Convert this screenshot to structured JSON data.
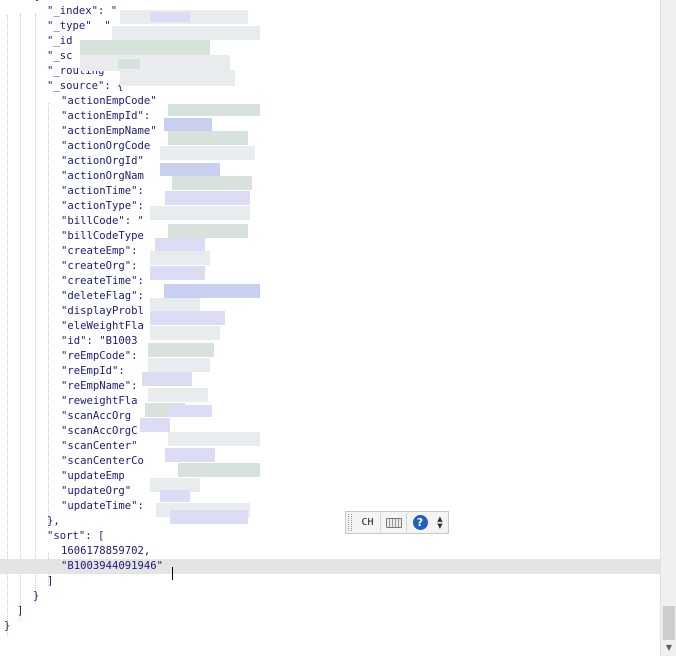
{
  "editor": {
    "lines": [
      {
        "indent": 2,
        "text": "{"
      },
      {
        "indent": 3,
        "text": "\"_index\": \""
      },
      {
        "indent": 3,
        "text": "\"_type\"  \""
      },
      {
        "indent": 3,
        "text": "\"_id"
      },
      {
        "indent": 3,
        "text": "\"_sc"
      },
      {
        "indent": 3,
        "text": "\"_routing"
      },
      {
        "indent": 3,
        "text": "\"_source\": {"
      },
      {
        "indent": 4,
        "text": "\"actionEmpCode\""
      },
      {
        "indent": 4,
        "text": "\"actionEmpId\":"
      },
      {
        "indent": 4,
        "text": "\"actionEmpName\""
      },
      {
        "indent": 4,
        "text": "\"actionOrgCode"
      },
      {
        "indent": 4,
        "text": "\"actionOrgId\""
      },
      {
        "indent": 4,
        "text": "\"actionOrgNam"
      },
      {
        "indent": 4,
        "text": "\"actionTime\":"
      },
      {
        "indent": 4,
        "text": "\"actionType\":"
      },
      {
        "indent": 4,
        "text": "\"billCode\": \""
      },
      {
        "indent": 4,
        "text": "\"billCodeType"
      },
      {
        "indent": 4,
        "text": "\"createEmp\":"
      },
      {
        "indent": 4,
        "text": "\"createOrg\":"
      },
      {
        "indent": 4,
        "text": "\"createTime\":"
      },
      {
        "indent": 4,
        "text": "\"deleteFlag\":"
      },
      {
        "indent": 4,
        "text": "\"displayProbl"
      },
      {
        "indent": 4,
        "text": "\"eleWeightFla"
      },
      {
        "indent": 4,
        "text": "\"id\": \"B1003"
      },
      {
        "indent": 4,
        "text": "\"reEmpCode\":"
      },
      {
        "indent": 4,
        "text": "\"reEmpId\":"
      },
      {
        "indent": 4,
        "text": "\"reEmpName\":"
      },
      {
        "indent": 4,
        "text": "\"reweightFla"
      },
      {
        "indent": 4,
        "text": "\"scanAccOrg"
      },
      {
        "indent": 4,
        "text": "\"scanAccOrgC"
      },
      {
        "indent": 4,
        "text": "\"scanCenter\""
      },
      {
        "indent": 4,
        "text": "\"scanCenterCo"
      },
      {
        "indent": 4,
        "text": "\"updateEmp"
      },
      {
        "indent": 4,
        "text": "\"updateOrg\""
      },
      {
        "indent": 4,
        "text": "\"updateTime\":"
      },
      {
        "indent": 3,
        "text": "},"
      },
      {
        "indent": 3,
        "text": "\"sort\": ["
      },
      {
        "indent": 4,
        "text": "1606178859702,"
      },
      {
        "indent": 4,
        "text": "\"B1003944091946\""
      },
      {
        "indent": 3,
        "text": "]"
      },
      {
        "indent": 2,
        "text": "}"
      },
      {
        "indent": 1,
        "text": "]"
      },
      {
        "indent": 0,
        "text": "}"
      }
    ]
  },
  "ime_toolbar": {
    "language_label": "CH",
    "keyboard_icon": "keyboard-icon",
    "help_icon": "help-icon",
    "help_glyph": "?",
    "options_icon": "options-icon",
    "options_up": "▲",
    "options_down": "▼"
  },
  "scrollbar": {
    "down_arrow_glyph": "▼"
  }
}
